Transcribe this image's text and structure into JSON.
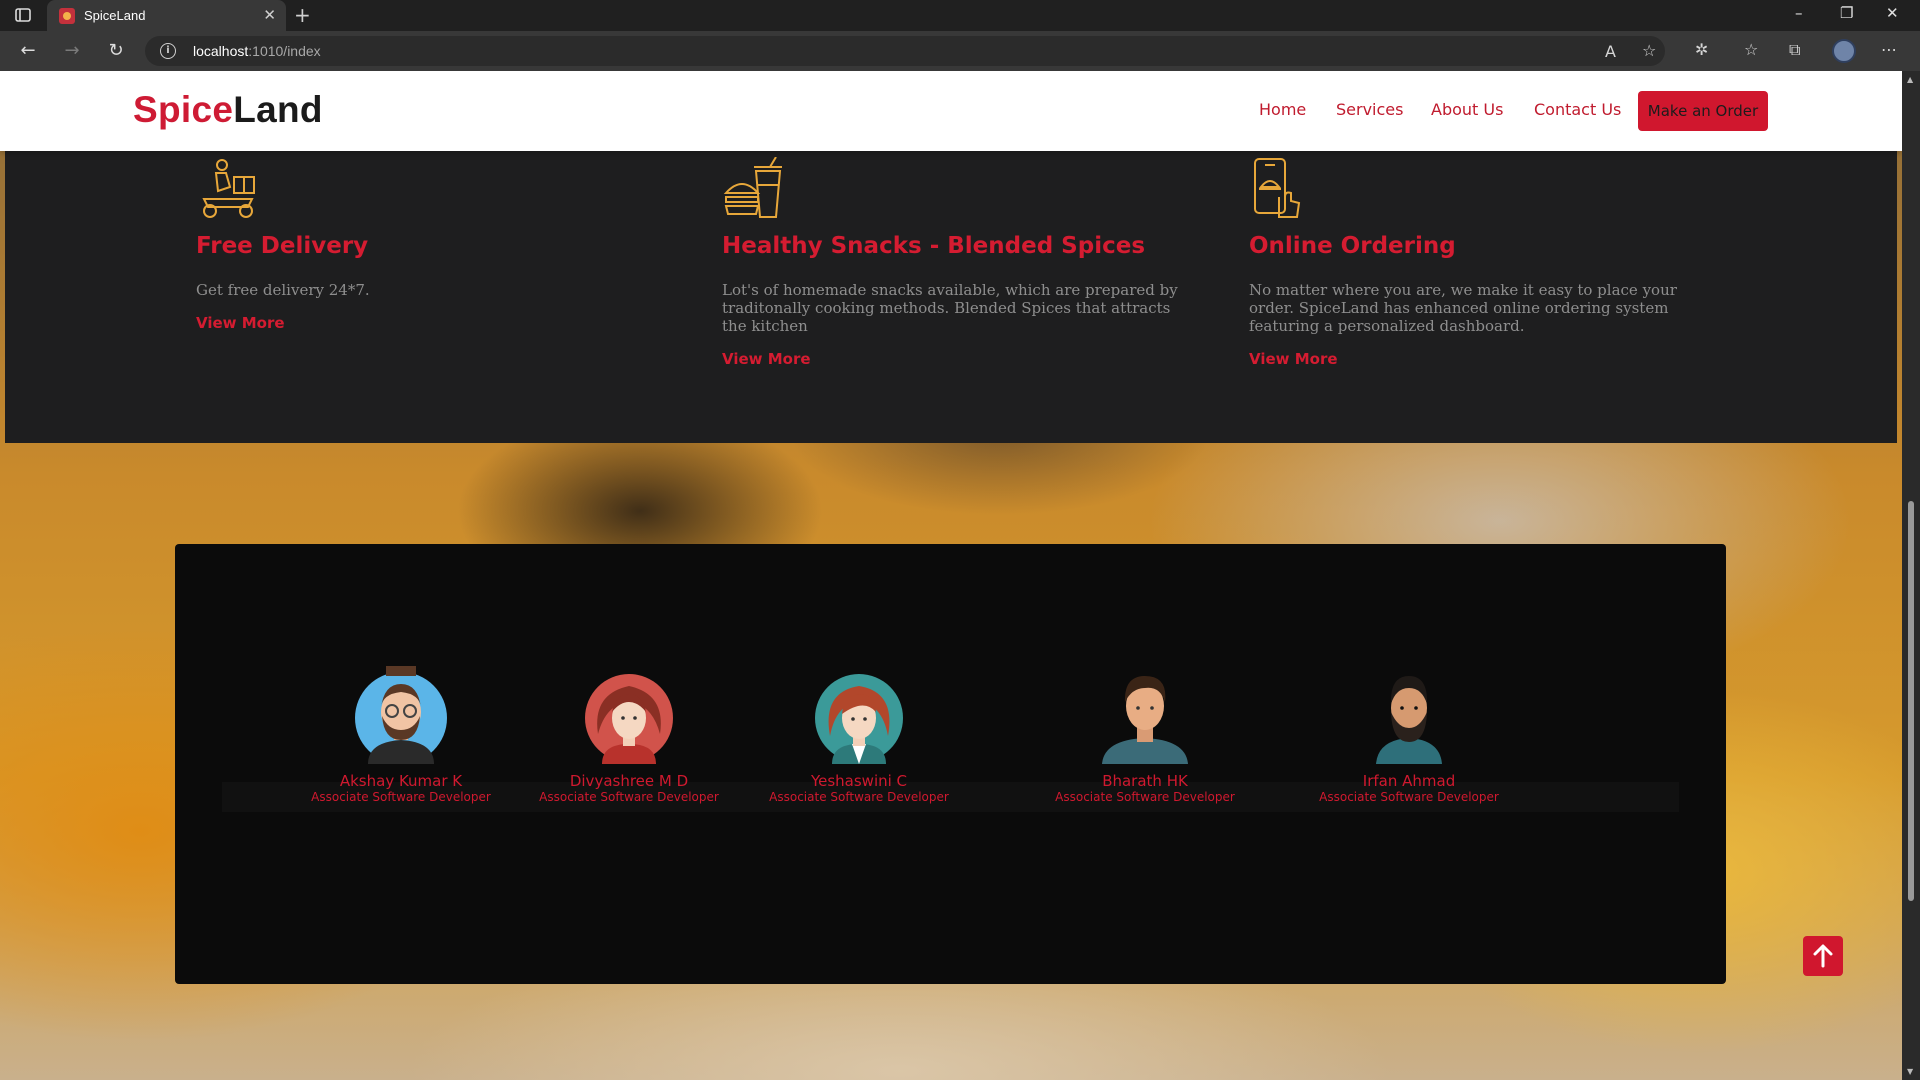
{
  "browser": {
    "tab_title": "SpiceLand",
    "url_host": "localhost",
    "url_rest": ":1010/index"
  },
  "site": {
    "logo_part1": "Spice",
    "logo_part2": "Land",
    "nav": [
      "Home",
      "Services",
      "About Us",
      "Contact Us"
    ],
    "cta": "Make an Order"
  },
  "services": [
    {
      "icon": "delivery-scooter-icon",
      "title": "Free Delivery",
      "text": "Get free delivery 24*7.",
      "link": "View More"
    },
    {
      "icon": "burger-drink-icon",
      "title": "Healthy Snacks - Blended Spices",
      "text": "Lot's of homemade snacks available, which are prepared by traditonally cooking methods. Blended Spices that attracts the kitchen",
      "link": "View More"
    },
    {
      "icon": "mobile-ordering-icon",
      "title": "Online Ordering",
      "text": "No matter where you are, we make it easy to place your order. SpiceLand has enhanced online ordering system featuring a personalized dashboard.",
      "link": "View More"
    }
  ],
  "team": [
    {
      "name": "Akshay Kumar K",
      "role": "Associate Software Developer"
    },
    {
      "name": "Divyashree M D",
      "role": "Associate Software Developer"
    },
    {
      "name": "Yeshaswini C",
      "role": "Associate Software Developer"
    },
    {
      "name": "Bharath HK",
      "role": "Associate Software Developer"
    },
    {
      "name": "Irfan Ahmad",
      "role": "Associate Software Developer"
    }
  ],
  "colors": {
    "brand_red": "#d0172e",
    "icon_gold": "#e7a73a",
    "dark_band": "#1e1e1f"
  }
}
